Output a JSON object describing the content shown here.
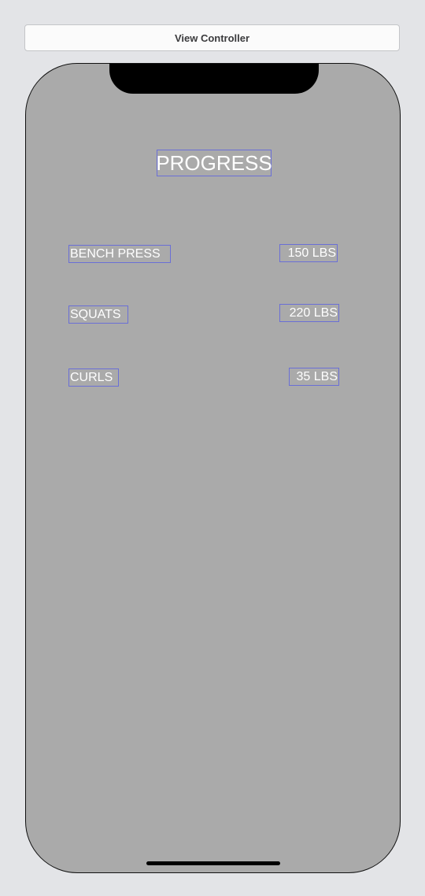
{
  "scene": {
    "title": "View Controller"
  },
  "screen": {
    "title": "PROGRESS",
    "rows": [
      {
        "exercise": "BENCH PRESS",
        "weight": "150 LBS"
      },
      {
        "exercise": "SQUATS",
        "weight": "220 LBS"
      },
      {
        "exercise": "CURLS",
        "weight": "35 LBS"
      }
    ]
  },
  "colors": {
    "background": "#aaaaaa",
    "label_text": "#ffffff",
    "label_outline": "#6a6fd6"
  }
}
